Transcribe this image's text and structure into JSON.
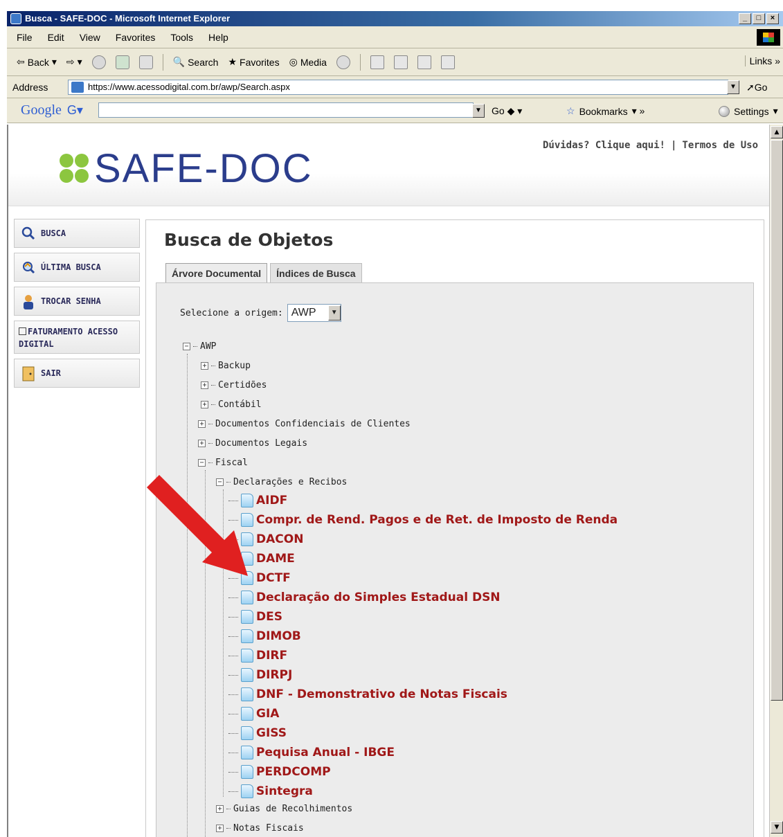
{
  "browser": {
    "title": "Busca - SAFE-DOC - Microsoft Internet Explorer",
    "menu": [
      "File",
      "Edit",
      "View",
      "Favorites",
      "Tools",
      "Help"
    ],
    "toolbar": [
      "Back",
      "Search",
      "Favorites",
      "Media"
    ],
    "links_label": "Links",
    "address_label": "Address",
    "address_url": "https://www.acessodigital.com.br/awp/Search.aspx",
    "go_label": "Go",
    "google_logo": "Google",
    "google_go": "Go",
    "bookmarks_label": "Bookmarks",
    "settings_label": "Settings"
  },
  "header": {
    "logo_text": "SAFE-DOC",
    "help_link": "Dúvidas? Clique aqui!",
    "terms_link": "Termos de Uso"
  },
  "sidebar": {
    "items": [
      {
        "label": "BUSCA",
        "icon": "magnifier-icon"
      },
      {
        "label": "ÚLTIMA BUSCA",
        "icon": "recent-search-icon"
      },
      {
        "label": "TROCAR SENHA",
        "icon": "user-icon"
      },
      {
        "label": "FATURAMENTO ACESSO DIGITAL",
        "icon": "checkbox-icon"
      },
      {
        "label": "SAIR",
        "icon": "exit-door-icon"
      }
    ]
  },
  "main": {
    "title": "Busca de Objetos",
    "tabs": [
      "Árvore Documental",
      "Índices de Busca"
    ],
    "origin_label": "Selecione a origem:",
    "origin_value": "AWP"
  },
  "tree": {
    "root": "AWP",
    "folders": [
      "Backup",
      "Certidões",
      "Contábil",
      "Documentos Confidenciais de Clientes",
      "Documentos Legais",
      "Fiscal"
    ],
    "subfolder": "Declarações e Recibos",
    "documents": [
      "AIDF",
      "Compr. de Rend. Pagos e de Ret. de Imposto de Renda",
      "DACON",
      "DAME",
      "DCTF",
      "Declaração do Simples Estadual DSN",
      "DES",
      "DIMOB",
      "DIRF",
      "DIRPJ",
      "DNF - Demonstrativo de Notas Fiscais",
      "GIA",
      "GISS",
      "Pequisa Anual - IBGE",
      "PERDCOMP",
      "Sintegra"
    ],
    "more_folders": [
      "Guias de Recolhimentos",
      "Notas Fiscais"
    ]
  },
  "colors": {
    "leaf_text": "#a01818",
    "arrow": "#e02020",
    "logo_text": "#2b3d8c",
    "logo_mark": "#8cc63f"
  }
}
